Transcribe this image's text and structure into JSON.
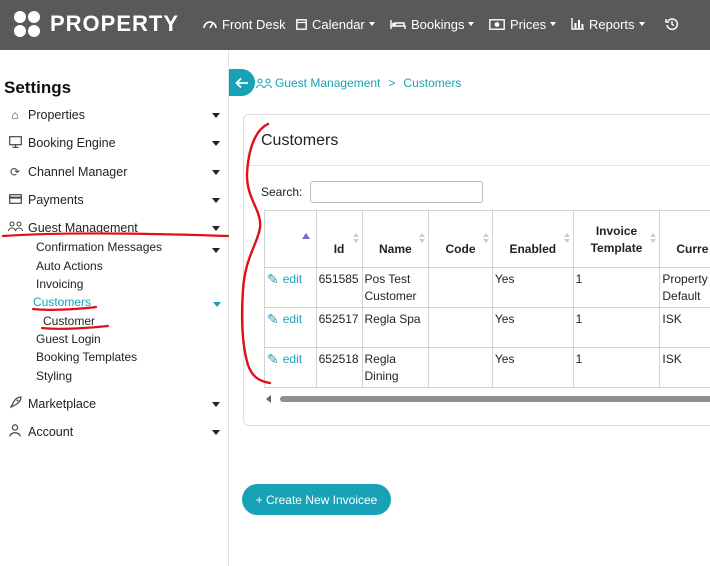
{
  "brand": {
    "name": "PROPERTY"
  },
  "nav": [
    {
      "label": "Front Desk",
      "icon": "dashboard-icon"
    },
    {
      "label": "Calendar",
      "icon": "calendar-icon"
    },
    {
      "label": "Bookings",
      "icon": "bed-icon"
    },
    {
      "label": "Prices",
      "icon": "money-icon"
    },
    {
      "label": "Reports",
      "icon": "chart-icon"
    },
    {
      "label": "",
      "icon": "history-icon"
    }
  ],
  "sidebar": {
    "title": "Settings",
    "items": [
      {
        "label": "Properties",
        "icon": "home-icon"
      },
      {
        "label": "Booking Engine",
        "icon": "monitor-icon"
      },
      {
        "label": "Channel Manager",
        "icon": "sync-icon"
      },
      {
        "label": "Payments",
        "icon": "card-icon"
      },
      {
        "label": "Guest Management",
        "icon": "users-icon"
      },
      {
        "label": "Marketplace",
        "icon": "rocket-icon"
      },
      {
        "label": "Account",
        "icon": "user-icon"
      }
    ],
    "guest_submenu": [
      {
        "label": "Confirmation Messages"
      },
      {
        "label": "Auto Actions"
      },
      {
        "label": "Invoicing"
      },
      {
        "label": "Customers"
      },
      {
        "label": "Customer"
      },
      {
        "label": "Guest Login"
      },
      {
        "label": "Booking Templates"
      },
      {
        "label": "Styling"
      }
    ]
  },
  "breadcrumb": {
    "section": "Guest Management",
    "separator": ">",
    "page": "Customers"
  },
  "customers": {
    "title": "Customers",
    "search_label": "Search:",
    "search_value": "",
    "columns": [
      "",
      "Id",
      "Name",
      "Code",
      "Enabled",
      "Invoice Template",
      "Curre"
    ],
    "rows": [
      {
        "action": "edit",
        "id": "651585",
        "name": "Pos Test Customer",
        "code": "",
        "enabled": "Yes",
        "template": "1",
        "currency": "Property Default"
      },
      {
        "action": "edit",
        "id": "652517",
        "name": "Regla Spa",
        "code": "",
        "enabled": "Yes",
        "template": "1",
        "currency": "ISK"
      },
      {
        "action": "edit",
        "id": "652518",
        "name": "Regla Dining",
        "code": "",
        "enabled": "Yes",
        "template": "1",
        "currency": "ISK"
      }
    ]
  },
  "create_button": {
    "label": "+ Create New Invoicee"
  },
  "colors": {
    "topbar": "#58595b",
    "accent": "#17a2b8",
    "annotation": "#e0101a"
  }
}
